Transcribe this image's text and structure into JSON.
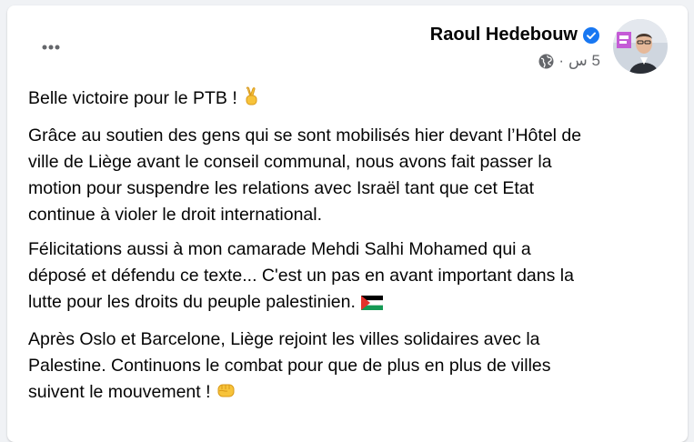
{
  "post": {
    "author": "Raoul Hedebouw",
    "timestamp": "5 س",
    "separator": "·",
    "paragraphs": [
      "Belle victoire pour le PTB !",
      "Grâce au soutien des gens qui se sont mobilisés hier devant l’Hôtel de\nville de Liège avant le conseil communal, nous avons fait passer la\nmotion pour suspendre les relations avec Israël tant que cet Etat\ncontinue à violer le droit international.",
      "Félicitations aussi à mon camarade Mehdi Salhi Mohamed qui a\ndéposé et défendu ce texte... C'est un pas en avant important dans la\nlutte pour les droits du peuple palestinien.",
      "Après Oslo et Barcelone, Liège rejoint les villes solidaires avec la\nPalestine. Continuons le combat pour que de plus en plus de villes\nsuivent le mouvement !"
    ],
    "emojis": [
      "victory-hand-emoji",
      "palestine-flag-emoji",
      "raised-fist-emoji"
    ]
  },
  "icons": {
    "more": "more-icon",
    "verified": "verified-badge-icon",
    "audience": "globe-icon"
  },
  "colors": {
    "verified_blue": "#1877f2",
    "secondary_text": "#65676b",
    "primary_text": "#050505"
  }
}
